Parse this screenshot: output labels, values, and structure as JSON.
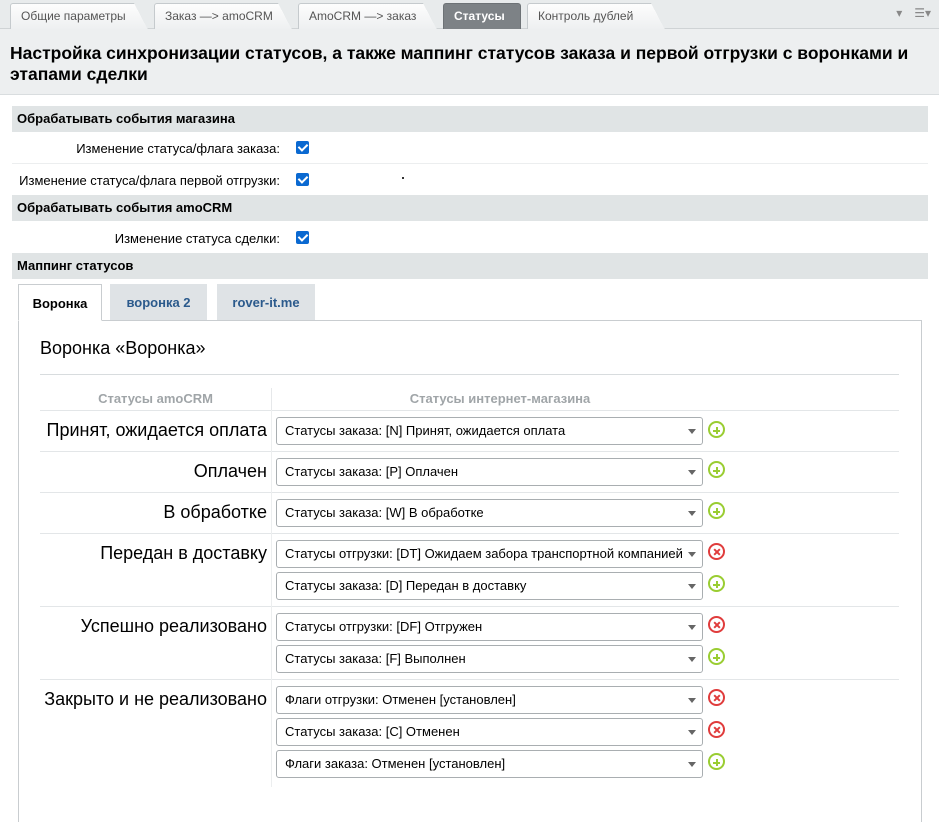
{
  "tabs": [
    {
      "label": "Общие параметры",
      "active": false
    },
    {
      "label": "Заказ —> amoCRM",
      "active": false
    },
    {
      "label": "AmoCRM —> заказ",
      "active": false
    },
    {
      "label": "Статусы",
      "active": true
    },
    {
      "label": "Контроль дублей",
      "active": false
    }
  ],
  "title": "Настройка синхронизации статусов, а также маппинг статусов заказа и первой отгрузки с воронками и этапами сделки",
  "sections": {
    "shop_events": {
      "header": "Обрабатывать события магазина",
      "fields": [
        {
          "label": "Изменение статуса/флага заказа:",
          "checked": true
        },
        {
          "label": "Изменение статуса/флага первой отгрузки:",
          "checked": true
        }
      ]
    },
    "amo_events": {
      "header": "Обрабатывать события amoCRM",
      "fields": [
        {
          "label": "Изменение статуса сделки:",
          "checked": true
        }
      ]
    },
    "mapping": {
      "header": "Маппинг статусов"
    }
  },
  "pipeline_tabs": [
    {
      "label": "Воронка",
      "active": true
    },
    {
      "label": "воронка 2",
      "active": false
    },
    {
      "label": "rover-it.me",
      "active": false
    }
  ],
  "panel": {
    "title": "Воронка «Воронка»",
    "col_amo": "Статусы amoCRM",
    "col_shop": "Статусы интернет-магазина",
    "rows": [
      {
        "amo": "Принят, ожидается оплата",
        "shop": [
          {
            "value": "Статусы заказа: [N] Принят, ожидается оплата",
            "action": "add"
          }
        ]
      },
      {
        "amo": "Оплачен",
        "shop": [
          {
            "value": "Статусы заказа: [P] Оплачен",
            "action": "add"
          }
        ]
      },
      {
        "amo": "В обработке",
        "shop": [
          {
            "value": "Статусы заказа: [W] В обработке",
            "action": "add"
          }
        ]
      },
      {
        "amo": "Передан в доставку",
        "shop": [
          {
            "value": "Статусы отгрузки: [DT] Ожидаем забора транспортной компанией",
            "action": "remove"
          },
          {
            "value": "Статусы заказа: [D] Передан в доставку",
            "action": "add"
          }
        ]
      },
      {
        "amo": "Успешно реализовано",
        "shop": [
          {
            "value": "Статусы отгрузки: [DF] Отгружен",
            "action": "remove"
          },
          {
            "value": "Статусы заказа: [F] Выполнен",
            "action": "add"
          }
        ]
      },
      {
        "amo": "Закрыто и не реализовано",
        "shop": [
          {
            "value": "Флаги отгрузки: Отменен [установлен]",
            "action": "remove"
          },
          {
            "value": "Статусы заказа: [C] Отменен",
            "action": "remove"
          },
          {
            "value": "Флаги заказа: Отменен [установлен]",
            "action": "add"
          }
        ]
      }
    ]
  },
  "icons": {
    "tab_menu": "chevron-down-icon",
    "settings_menu": "hamburger-menu-icon",
    "add": "plus-circle-icon",
    "remove": "x-circle-icon"
  },
  "colors": {
    "checkbox": "#0a69d1",
    "add": "#9acd32",
    "remove": "#e03c3c",
    "active_tab": "#7d8286",
    "link_tab": "#2b5a8c"
  }
}
